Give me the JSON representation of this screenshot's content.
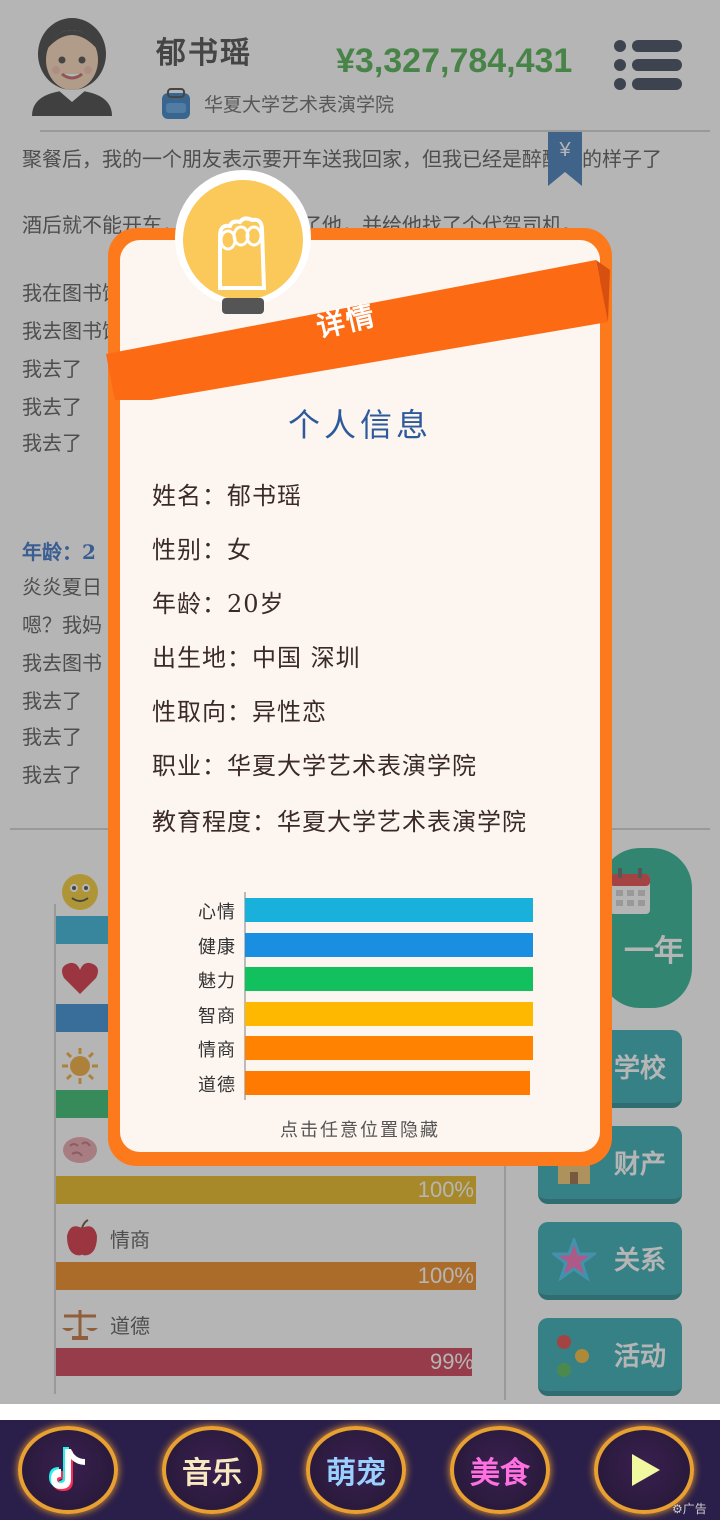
{
  "header": {
    "name": "郁书瑶",
    "school": "华夏大学艺术表演学院",
    "money": "¥3,327,784,431"
  },
  "story": {
    "line1": "聚餐后，我的一个朋友表示要开车送我回家，但我已经是醉醺醺的样子了",
    "line2a": "酒后就不能开车，我坚定地拒绝了他，并给他找了个代驾司机。",
    "line3": "我在图书馆找了一本书看，从中有所感悟",
    "line4": "我去图书馆",
    "line5": "我去了",
    "line6": "我去了",
    "line7": "我去了",
    "age_header": "年龄：2",
    "line8": "炎炎夏日",
    "line9": "嗯？我妈",
    "line10": "我去图书",
    "line11": "我去了",
    "line12": "我去了",
    "line13": "我去了",
    "bookmark_symbol": "¥"
  },
  "stats": {
    "iq_pct": "100%",
    "eq_label": "情商",
    "eq_pct": "100%",
    "moral_label": "道德",
    "moral_pct": "99%",
    "colors": {
      "mood": "#1aa9d3",
      "health": "#1e7fd0",
      "charm": "#1bb35a",
      "iq": "#e8b000",
      "eq": "#ef7b00",
      "moral": "#c8233c"
    }
  },
  "side_buttons": {
    "next_year": "一年",
    "school": "学校",
    "property": "财产",
    "relation": "关系",
    "activity": "活动"
  },
  "modal": {
    "ribbon": "详情",
    "title": "个人信息",
    "name_row": "姓名：郁书瑶",
    "gender_row": "性别：女",
    "age_row": "年龄：20岁",
    "birthplace_row": "出生地：中国 深圳",
    "orientation_row": "性取向：异性恋",
    "job_row": "职业：华夏大学艺术表演学院",
    "education_row": "教育程度：华夏大学艺术表演学院",
    "hint": "点击任意位置隐藏"
  },
  "chart_data": {
    "type": "bar",
    "categories": [
      "心情",
      "健康",
      "魅力",
      "智商",
      "情商",
      "道德"
    ],
    "values": [
      100,
      100,
      100,
      100,
      100,
      99
    ],
    "colors": [
      "#1ab0dc",
      "#1a8ee0",
      "#12c05e",
      "#ffb800",
      "#ff8200",
      "#ff7a00"
    ],
    "xlim": [
      0,
      100
    ]
  },
  "bottom_bar": {
    "music": "音乐",
    "pets": "萌宠",
    "food": "美食",
    "ad": "广告"
  }
}
